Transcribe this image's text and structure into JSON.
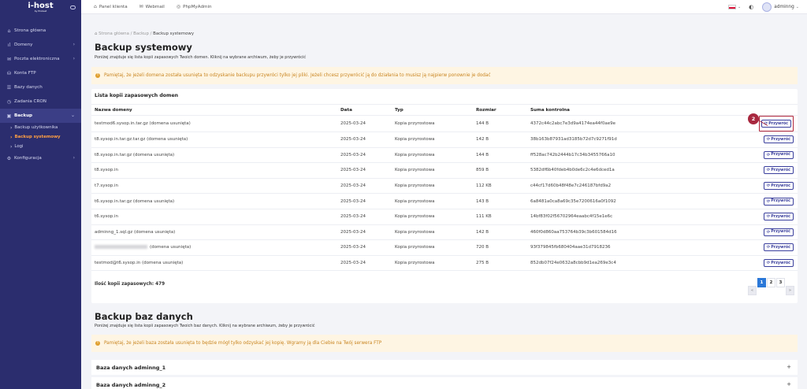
{
  "brand": {
    "name": "i-host",
    "tagline": "by Pinkset"
  },
  "topbar": {
    "links": [
      {
        "label": "Panel klienta",
        "icon": "home-icon"
      },
      {
        "label": "Webmail",
        "icon": "mail-icon"
      },
      {
        "label": "PhpMyAdmin",
        "icon": "database-icon"
      }
    ],
    "username": "adminng"
  },
  "sidebar": {
    "items": [
      {
        "label": "Strona główna",
        "icon": "home-icon"
      },
      {
        "label": "Domeny",
        "icon": "chart-icon"
      },
      {
        "label": "Poczta elektroniczna",
        "icon": "mail-icon"
      },
      {
        "label": "Konta FTP",
        "icon": "ftp-icon"
      },
      {
        "label": "Bazy danych",
        "icon": "database-icon"
      },
      {
        "label": "Zadania CRON",
        "icon": "clock-icon"
      },
      {
        "label": "Backup",
        "icon": "backup-icon"
      },
      {
        "label": "Konfiguracja",
        "icon": "gear-icon"
      }
    ],
    "backup_sub": [
      "Backup użytkownika",
      "Backup systemowy",
      "Logi"
    ]
  },
  "breadcrumb": [
    "Strona główna",
    "Backup",
    "Backup systemowy"
  ],
  "page": {
    "title": "Backup systemowy",
    "description": "Poniżej znajduje się lista kopii zapasowych Twoich domen. Kliknij na wybrane archiwum, żeby je przywrócić",
    "alert": "Pamiętaj, że jeżeli domena została usunięta to odzyskanie backupu przywróci tylko jej pliki. Jeżeli chcesz przywrócić ją do działania to musisz ją najpierw ponownie je dodać"
  },
  "domain_backups": {
    "title": "Lista kopii zapasowych domen",
    "columns": [
      "Nazwa domeny",
      "Data",
      "Typ",
      "Rozmiar",
      "Suma kontrolna"
    ],
    "restore_label": "Przywróć",
    "rows": [
      {
        "name": "testmod6.sysop.in.tar.gz (domena usunięta)",
        "date": "2025-03-24",
        "type": "Kopia przyrostowa",
        "size": "144 B",
        "hash": "4372c44c2abc7e3d9a4174ea44f0ae9e"
      },
      {
        "name": "t8.sysop.in.tar.gz.tar.gz (domena usunięta)",
        "date": "2025-03-24",
        "type": "Kopia przyrostowa",
        "size": "142 B",
        "hash": "38b163b87931ad3185b72d7c9271f91d"
      },
      {
        "name": "t8.sysop.in.tar.gz (domena usunięta)",
        "date": "2025-03-24",
        "type": "Kopia przyrostowa",
        "size": "144 B",
        "hash": "ff528ac742b2444b17c34b3455766a10"
      },
      {
        "name": "t8.sysop.in",
        "date": "2025-03-24",
        "type": "Kopia przyrostowa",
        "size": "859 B",
        "hash": "5382df6b40fdeb4b0de6c2c4e6dced1a"
      },
      {
        "name": "t7.sysop.in",
        "date": "2025-03-24",
        "type": "Kopia przyrostowa",
        "size": "112 KB",
        "hash": "c44cf17d60b48f48e7c246187bfd9a2"
      },
      {
        "name": "t6.sysop.in.tar.gz (domena usunięta)",
        "date": "2025-03-24",
        "type": "Kopia przyrostowa",
        "size": "143 B",
        "hash": "6a8481a0ca8a69c35e7200616a0f1092"
      },
      {
        "name": "t6.sysop.in",
        "date": "2025-03-24",
        "type": "Kopia przyrostowa",
        "size": "111 KB",
        "hash": "14bf83f02f56702964eaabc4f15e1e6c"
      },
      {
        "name": "adminng_1.sql.gz (domena usunięta)",
        "date": "2025-03-24",
        "type": "Kopia przyrostowa",
        "size": "142 B",
        "hash": "460f0d860aa753764b39c3b601584d16"
      },
      {
        "name": "(domena usunięta)",
        "date": "2025-03-24",
        "type": "Kopia przyrostowa",
        "size": "720 B",
        "hash": "93f379845fb680404aae31d7918236",
        "blurred": true
      },
      {
        "name": "testmod@t6.sysop.in (domena usunięta)",
        "date": "2025-03-24",
        "type": "Kopia przyrostowa",
        "size": "275 B",
        "hash": "852db07f24e0632a8cbb9d1ea269e3c4"
      }
    ],
    "count_label": "Ilość kopii zapasowych: 479",
    "pager": [
      "«",
      "1",
      "2",
      "3",
      "»"
    ],
    "marker": "2"
  },
  "db_backups": {
    "title": "Backup baz danych",
    "description": "Poniżej znajduje się lista kopii zapasowych Twoich baz danych. Kliknij na wybrane archiwum, żeby je przywrócić",
    "alert": "Pamiętaj, że jeżeli baza została usunięta to będzie mógł tylko odzyskać jej kopię. Wgramy ją dla Ciebie na Twój serwera FTP",
    "items": [
      "Baza danych adminng_1",
      "Baza danych adminng_2"
    ],
    "expand_symbol": "+"
  },
  "colors": {
    "sidebar": "#2b2d6e",
    "accent": "#3a3f9d",
    "highlight": "#a8283f",
    "warning_text": "#c98520"
  }
}
